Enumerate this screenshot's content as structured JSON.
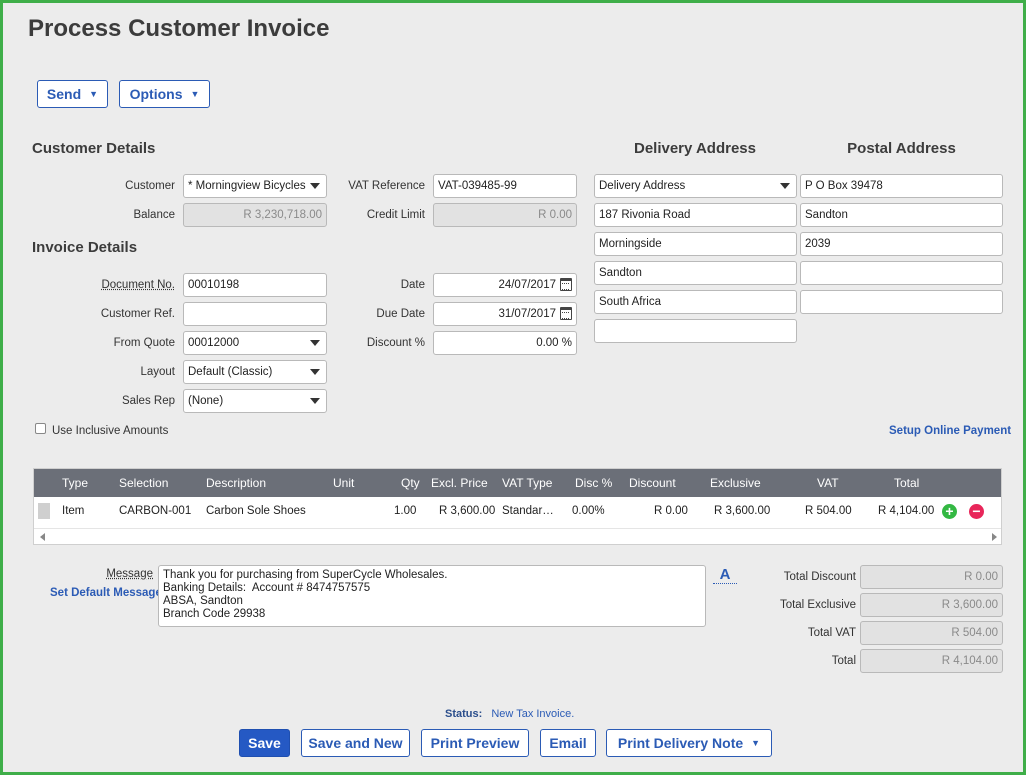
{
  "page": {
    "title": "Process Customer Invoice"
  },
  "top_buttons": {
    "send": "Send",
    "options": "Options"
  },
  "customer_details": {
    "heading": "Customer Details",
    "customer_label": "Customer",
    "customer_value": "* Morningview Bicycles",
    "balance_label": "Balance",
    "balance_value": "R 3,230,718.00",
    "vat_ref_label": "VAT Reference",
    "vat_ref_value": "VAT-039485-99",
    "credit_limit_label": "Credit Limit",
    "credit_limit_value": "R 0.00"
  },
  "invoice_details": {
    "heading": "Invoice Details",
    "doc_no_label": "Document No.",
    "doc_no_value": "00010198",
    "customer_ref_label": "Customer Ref.",
    "customer_ref_value": "",
    "from_quote_label": "From Quote",
    "from_quote_value": "00012000",
    "layout_label": "Layout",
    "layout_value": "Default (Classic)",
    "sales_rep_label": "Sales Rep",
    "sales_rep_value": "(None)",
    "date_label": "Date",
    "date_value": "24/07/2017",
    "due_date_label": "Due Date",
    "due_date_value": "31/07/2017",
    "discount_label": "Discount %",
    "discount_value": "0.00 %",
    "inclusive_label": "Use Inclusive Amounts"
  },
  "delivery_address": {
    "heading": "Delivery Address",
    "select_value": "Delivery Address",
    "lines": [
      "187 Rivonia Road",
      "Morningside",
      "Sandton",
      "South Africa",
      ""
    ]
  },
  "postal_address": {
    "heading": "Postal Address",
    "lines": [
      "P O Box 39478",
      "Sandton",
      "2039",
      "",
      ""
    ]
  },
  "setup_online_payment": "Setup Online Payment",
  "grid": {
    "headers": [
      "Type",
      "Selection",
      "Description",
      "Unit",
      "Qty",
      "Excl. Price",
      "VAT Type",
      "Disc %",
      "Discount",
      "Exclusive",
      "VAT",
      "Total"
    ],
    "row": {
      "type": "Item",
      "selection": "CARBON-001",
      "description": "Carbon Sole Shoes",
      "unit": "",
      "qty": "1.00",
      "excl_price": "R 3,600.00",
      "vat_type": "Standar…",
      "disc_pct": "0.00%",
      "discount": "R 0.00",
      "exclusive": "R 3,600.00",
      "vat": "R 504.00",
      "total": "R 4,104.00"
    },
    "add_symbol": "+",
    "remove_symbol": "−"
  },
  "message": {
    "label": "Message",
    "set_default": "Set Default Message",
    "text": "Thank you for purchasing from SuperCycle Wholesales.\nBanking Details:  Account # 8474757575\nABSA, Sandton\nBranch Code 29938",
    "format_button": "A"
  },
  "totals": {
    "total_discount_label": "Total Discount",
    "total_discount_value": "R 0.00",
    "total_exclusive_label": "Total Exclusive",
    "total_exclusive_value": "R 3,600.00",
    "total_vat_label": "Total VAT",
    "total_vat_value": "R 504.00",
    "total_label": "Total",
    "total_value": "R 4,104.00"
  },
  "status": {
    "label": "Status:",
    "value": "New Tax Invoice."
  },
  "bottom_buttons": {
    "save": "Save",
    "save_and_new": "Save and New",
    "print_preview": "Print Preview",
    "email": "Email",
    "print_delivery_note": "Print Delivery Note"
  },
  "colors": {
    "frame_border": "#3fae49",
    "accent_blue": "#2b5bb5",
    "grid_header": "#6b6f78",
    "add_green": "#33b843",
    "remove_red": "#e8265a"
  }
}
